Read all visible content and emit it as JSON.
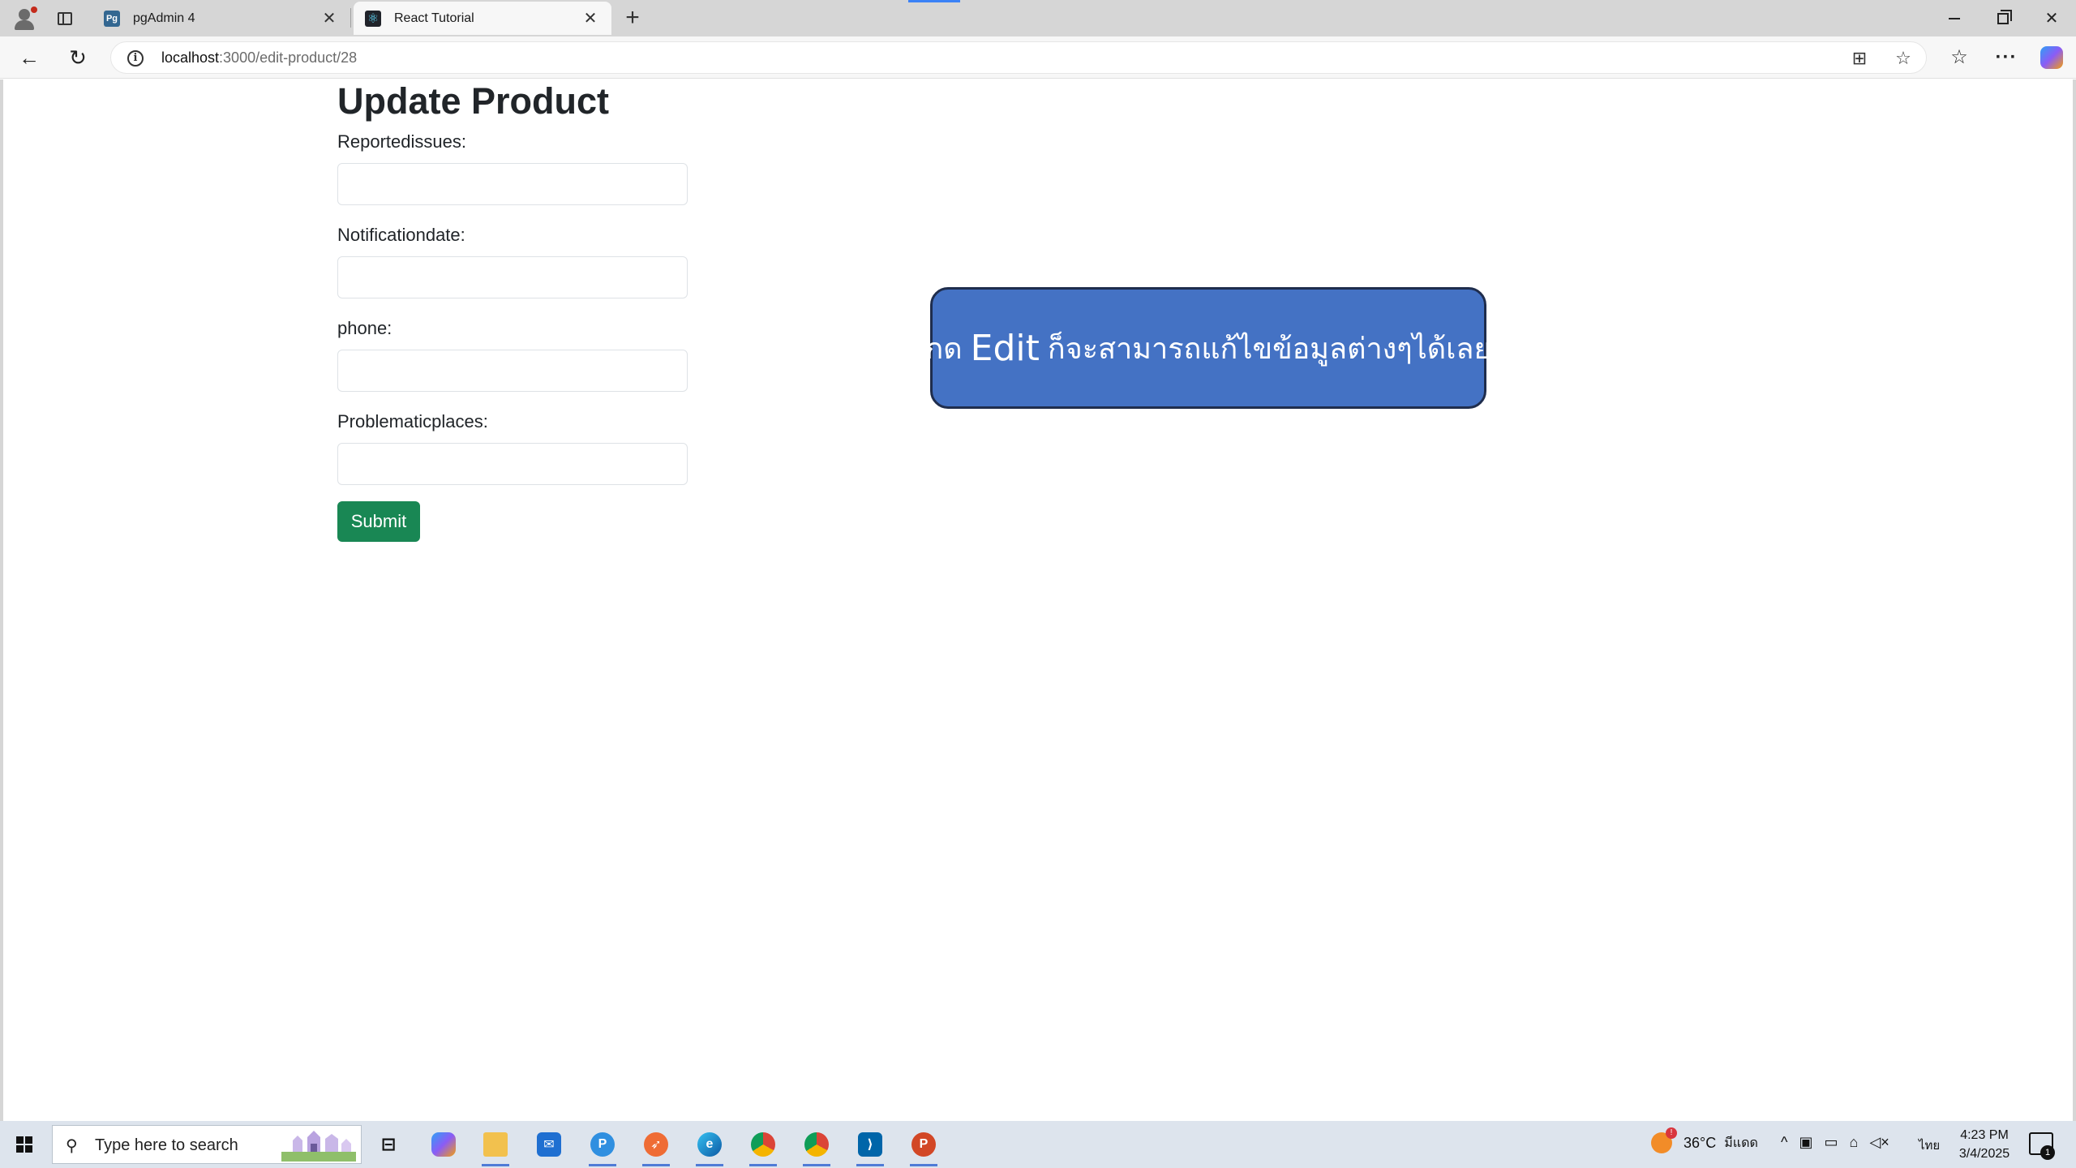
{
  "browser": {
    "tabs": [
      {
        "title": "pgAdmin 4",
        "favicon": "pg"
      },
      {
        "title": "React Tutorial",
        "favicon": "react"
      }
    ],
    "url_host": "localhost",
    "url_path": ":3000/edit-product/28"
  },
  "page": {
    "title": "Update Product",
    "fields": [
      {
        "label": "Reportedissues:",
        "value": ""
      },
      {
        "label": "Notificationdate:",
        "value": ""
      },
      {
        "label": "phone:",
        "value": ""
      },
      {
        "label": "Problematicplaces:",
        "value": ""
      }
    ],
    "submit_label": "Submit",
    "submit_color": "#198754"
  },
  "callout": {
    "prefix": "กด",
    "edit_word": "Edit",
    "suffix": "ก็จะสามารถแก้ไขข้อมูลต่างๆได้เลย",
    "color": "#4472c4"
  },
  "taskbar": {
    "search_placeholder": "Type here to search",
    "weather_temp": "36°C",
    "weather_desc": "มีแดด",
    "lang": "ไทย",
    "time": "4:23 PM",
    "date": "3/4/2025",
    "notification_count": "1"
  }
}
